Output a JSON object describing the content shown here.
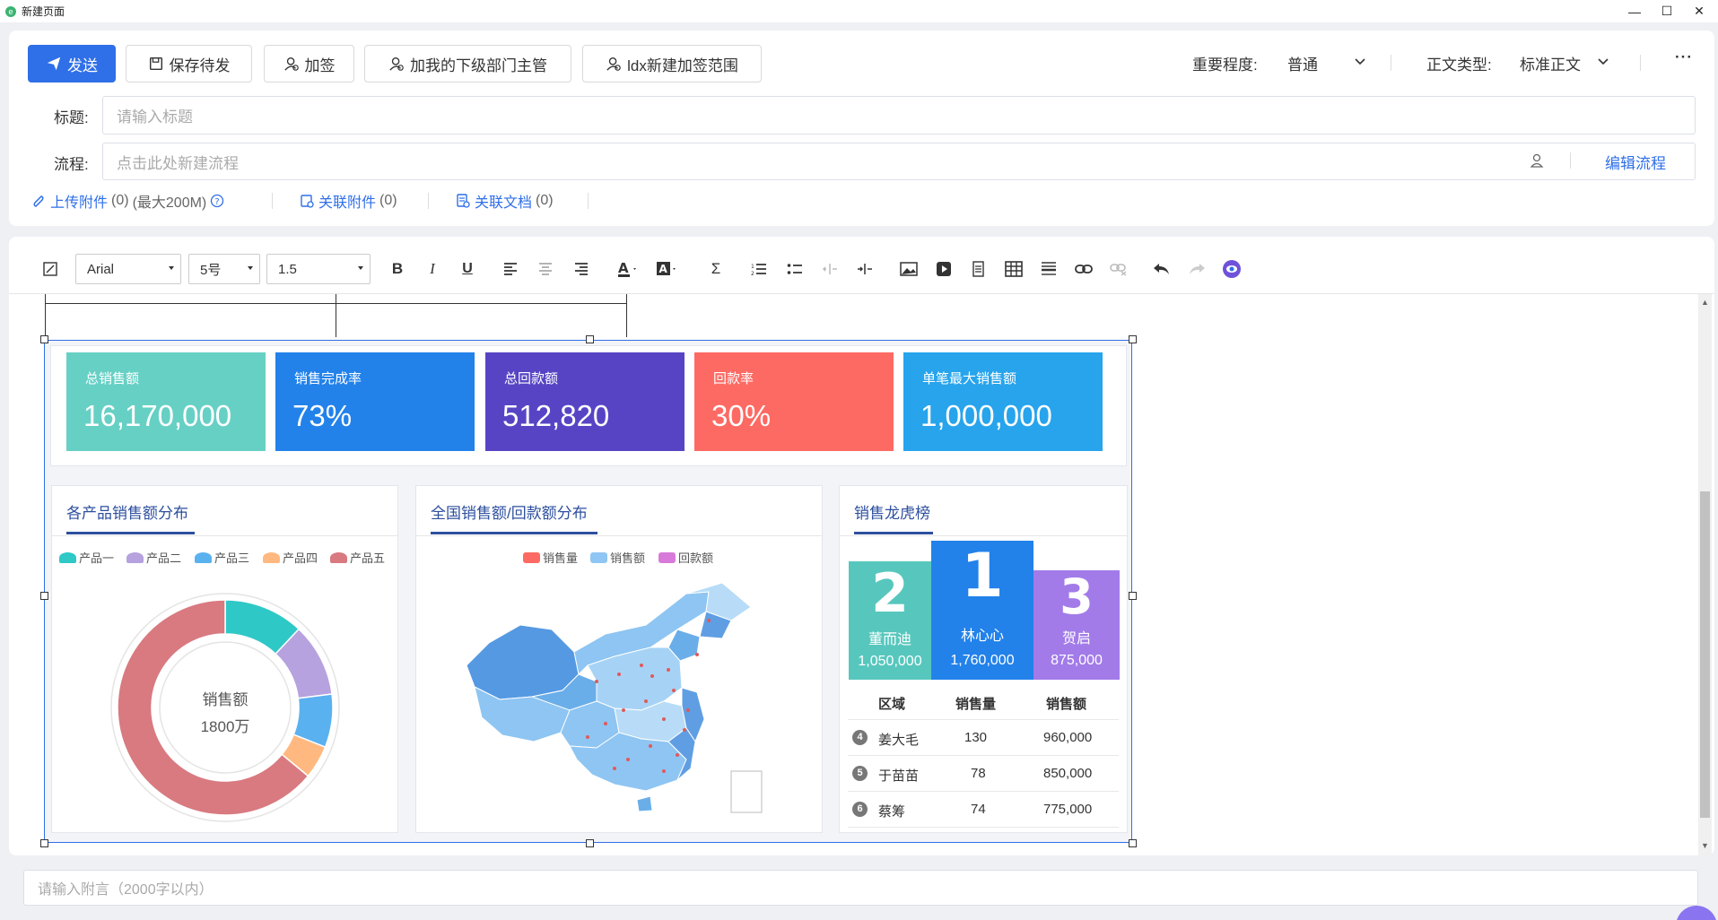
{
  "window": {
    "title": "新建页面",
    "minimize": "—",
    "maximize": "☐",
    "close": "✕"
  },
  "toolbar": {
    "send": "发送",
    "save": "保存待发",
    "sign": "加签",
    "add_manager": "加我的下级部门主管",
    "add_range": "ldx新建加签范围",
    "importance_label": "重要程度:",
    "importance_value": "普通",
    "doc_type_label": "正文类型:",
    "doc_type_value": "标准正文",
    "more": "···"
  },
  "form": {
    "title_label": "标题:",
    "title_placeholder": "请输入标题",
    "flow_label": "流程:",
    "flow_placeholder": "点击此处新建流程",
    "edit_flow": "编辑流程"
  },
  "attachments": {
    "upload": "上传附件",
    "upload_count": "(0)",
    "upload_limit": "(最大200M)",
    "related_attach": "关联附件",
    "related_attach_count": "(0)",
    "related_doc": "关联文档",
    "related_doc_count": "(0)"
  },
  "editor": {
    "font": "Arial",
    "size": "5号",
    "line_height": "1.5"
  },
  "kpis": [
    {
      "label": "总销售额",
      "value": "16,170,000",
      "color": "#67d0c5"
    },
    {
      "label": "销售完成率",
      "value": "73%",
      "color": "#2282ea"
    },
    {
      "label": "总回款额",
      "value": "512,820",
      "color": "#5744c5"
    },
    {
      "label": "回款率",
      "value": "30%",
      "color": "#fd6a63"
    },
    {
      "label": "单笔最大销售额",
      "value": "1,000,000",
      "color": "#27a4ec"
    }
  ],
  "panels": {
    "product_dist": "各产品销售额分布",
    "national": "全国销售额/回款额分布",
    "ranking": "销售龙虎榜"
  },
  "chart_data": [
    {
      "type": "pie",
      "title": "各产品销售额分布",
      "center_label": "销售额",
      "center_value": "1800万",
      "categories": [
        "产品一",
        "产品二",
        "产品三",
        "产品四",
        "产品五"
      ],
      "values": [
        12,
        11,
        8,
        5,
        64
      ],
      "colors": [
        "#2ec8c6",
        "#b6a2de",
        "#5ab1ef",
        "#ffb980",
        "#d87a80"
      ]
    },
    {
      "type": "map",
      "title": "全国销售额/回款额分布",
      "series": [
        {
          "name": "销售量",
          "color": "#fd6a63"
        },
        {
          "name": "销售额",
          "color": "#8fc6f3"
        },
        {
          "name": "回款额",
          "color": "#d87ad9"
        }
      ],
      "regions": [
        "新疆",
        "西藏",
        "青海",
        "甘肃",
        "内蒙古",
        "黑龙江",
        "吉林",
        "辽宁",
        "北京",
        "天津",
        "河北",
        "山西",
        "陕西",
        "宁夏",
        "山东",
        "河南",
        "四川",
        "重庆",
        "湖北",
        "安徽",
        "江苏",
        "浙江",
        "湖南",
        "江西",
        "贵州",
        "云南",
        "广西",
        "广东",
        "福建",
        "台湾",
        "海南",
        "南海诸岛"
      ]
    }
  ],
  "ranking": {
    "podium": [
      {
        "rank": "2",
        "name": "董而迪",
        "value": "1,050,000",
        "color": "#57c7bd"
      },
      {
        "rank": "1",
        "name": "林心心",
        "value": "1,760,000",
        "color": "#2282ea"
      },
      {
        "rank": "3",
        "name": "贺启",
        "value": "875,000",
        "color": "#a27be9"
      }
    ],
    "columns": [
      "区域",
      "销售量",
      "销售额"
    ],
    "rows": [
      {
        "rank": "4",
        "name": "姜大毛",
        "qty": "130",
        "amount": "960,000"
      },
      {
        "rank": "5",
        "name": "于苗苗",
        "qty": "78",
        "amount": "850,000"
      },
      {
        "rank": "6",
        "name": "蔡筹",
        "qty": "74",
        "amount": "775,000"
      }
    ]
  },
  "footer": {
    "remark_placeholder": "请输入附言（2000字以内）"
  }
}
